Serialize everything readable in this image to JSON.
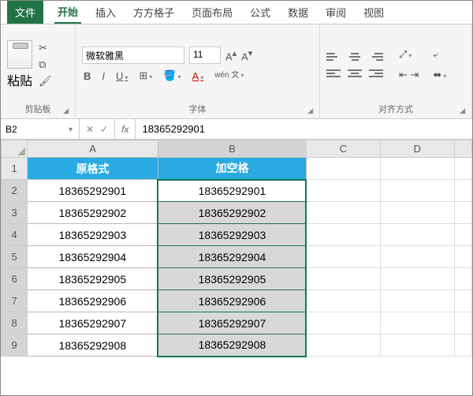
{
  "tabs": [
    "文件",
    "开始",
    "插入",
    "方方格子",
    "页面布局",
    "公式",
    "数据",
    "审阅",
    "视图"
  ],
  "activeTab": 1,
  "ribbon": {
    "clipboard": {
      "label": "剪贴板",
      "paste": "粘贴"
    },
    "font": {
      "label": "字体",
      "family": "微软雅黑",
      "size": "11",
      "bold": "B",
      "italic": "I",
      "under": "U",
      "wen": "wén\n文"
    },
    "align": {
      "label": "对齐方式"
    }
  },
  "namebox": "B2",
  "formula": "18365292901",
  "chart_data": {
    "type": "table",
    "columns": [
      "A",
      "B",
      "C",
      "D"
    ],
    "headerRow": [
      "原格式",
      "加空格",
      "",
      ""
    ],
    "rows": [
      [
        "18365292901",
        "18365292901",
        "",
        ""
      ],
      [
        "18365292902",
        "18365292902",
        "",
        ""
      ],
      [
        "18365292903",
        "18365292903",
        "",
        ""
      ],
      [
        "18365292904",
        "18365292904",
        "",
        ""
      ],
      [
        "18365292905",
        "18365292905",
        "",
        ""
      ],
      [
        "18365292906",
        "18365292906",
        "",
        ""
      ],
      [
        "18365292907",
        "18365292907",
        "",
        ""
      ],
      [
        "18365292908",
        "18365292908",
        "",
        ""
      ]
    ],
    "selection": "B2:B9",
    "activeCell": "B2"
  }
}
